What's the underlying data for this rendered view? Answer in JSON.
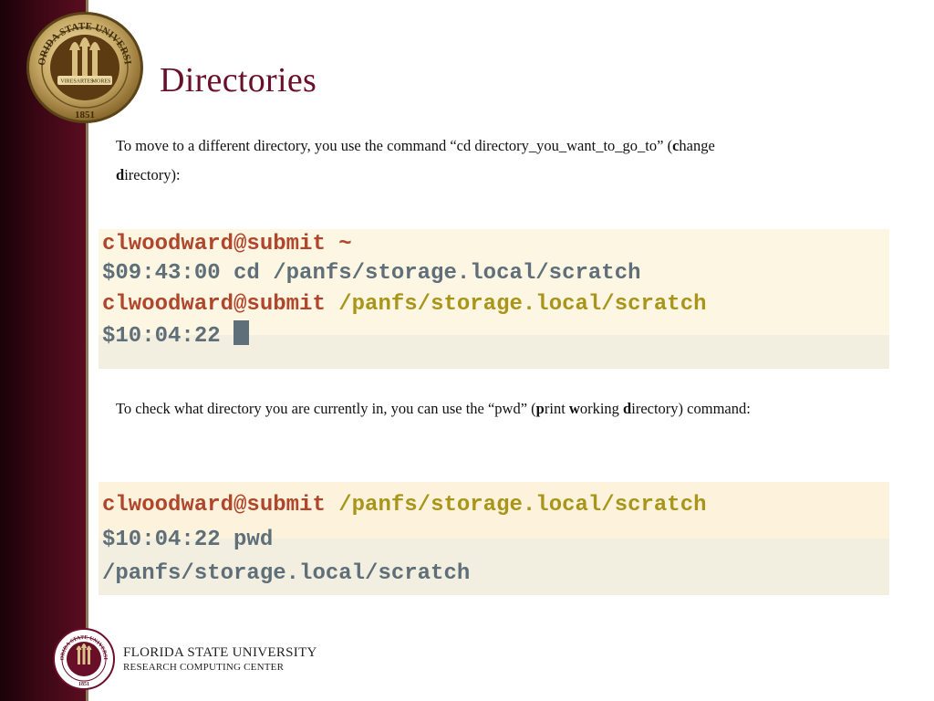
{
  "slide": {
    "title": "Directories",
    "para1": {
      "text": "To move to a different directory, you use the command “cd directory_you_want_to_go_to” (",
      "b1": "c",
      "t1": "hange ",
      "b2": "d",
      "t2": "irectory):"
    },
    "para2": {
      "text": "To check what directory you are currently in, you can use the “pwd” (",
      "b1": "p",
      "t1": "rint ",
      "b2": "w",
      "t2": "orking ",
      "b3": "d",
      "t3": "irectory) command:"
    }
  },
  "terminal1": {
    "line1_user": "clwoodward@submit",
    "line1_path": "~",
    "line2": "$09:43:00 cd /panfs/storage.local/scratch",
    "line3_user": "clwoodward@submit",
    "line3_path": "/panfs/storage.local/scratch",
    "line4": "$10:04:22 "
  },
  "terminal2": {
    "line1_user": "clwoodward@submit",
    "line1_path": "/panfs/storage.local/scratch",
    "line2": "$10:04:22 pwd",
    "line3": "/panfs/storage.local/scratch"
  },
  "footer": {
    "university": "FLORIDA STATE UNIVERSITY",
    "center": "RESEARCH COMPUTING CENTER"
  },
  "logo_text": {
    "ring": "FLORIDA STATE UNIVERSITY",
    "mottos": [
      "VIRES",
      "ARTES",
      "MORES"
    ],
    "year": "1851"
  },
  "colors": {
    "garnet": "#6a0f2a",
    "gold": "#c9b27c",
    "terminal_bg": "#fdf6e3",
    "prompt_user": "#b0462c",
    "prompt_path": "#a8951a",
    "terminal_text": "#5f6f7a"
  },
  "icons": [
    "fsu-seal-icon",
    "cursor-block-icon"
  ]
}
